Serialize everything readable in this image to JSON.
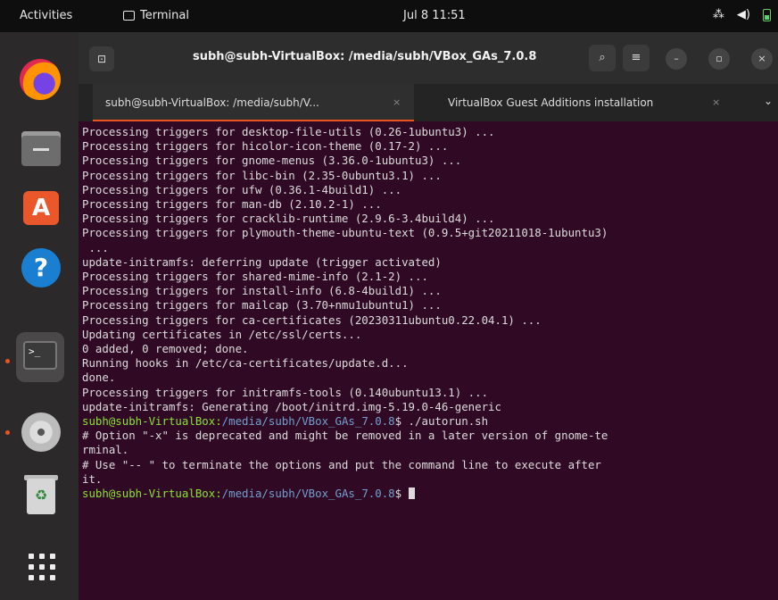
{
  "topbar": {
    "activities": "Activities",
    "app_name": "Terminal",
    "clock": "Jul 8  11:51",
    "tray_icons": [
      "network-icon",
      "volume-icon",
      "battery-icon"
    ]
  },
  "dock": {
    "items": [
      "firefox",
      "files",
      "ubuntu-software",
      "help",
      "terminal",
      "disc",
      "trash",
      "show-applications"
    ],
    "accent": "#e95420"
  },
  "window": {
    "title": "subh@subh-VirtualBox: /media/subh/VBox_GAs_7.0.8",
    "new_tab_icon": "⊡",
    "tabs": [
      {
        "label": "subh@subh-VirtualBox: /media/subh/V...",
        "close": "×"
      },
      {
        "label": "VirtualBox Guest Additions installation",
        "close": "×"
      }
    ],
    "tab_menu": "⌄"
  },
  "terminal": {
    "background": "#300a24",
    "lines": [
      "Processing triggers for desktop-file-utils (0.26-1ubuntu3) ...",
      "Processing triggers for hicolor-icon-theme (0.17-2) ...",
      "Processing triggers for gnome-menus (3.36.0-1ubuntu3) ...",
      "Processing triggers for libc-bin (2.35-0ubuntu3.1) ...",
      "Processing triggers for ufw (0.36.1-4build1) ...",
      "Processing triggers for man-db (2.10.2-1) ...",
      "Processing triggers for cracklib-runtime (2.9.6-3.4build4) ...",
      "Processing triggers for plymouth-theme-ubuntu-text (0.9.5+git20211018-1ubuntu3)",
      " ...",
      "update-initramfs: deferring update (trigger activated)",
      "Processing triggers for shared-mime-info (2.1-2) ...",
      "Processing triggers for install-info (6.8-4build1) ...",
      "Processing triggers for mailcap (3.70+nmu1ubuntu1) ...",
      "Processing triggers for ca-certificates (20230311ubuntu0.22.04.1) ...",
      "Updating certificates in /etc/ssl/certs...",
      "0 added, 0 removed; done.",
      "Running hooks in /etc/ca-certificates/update.d...",
      "done.",
      "Processing triggers for initramfs-tools (0.140ubuntu13.1) ...",
      "update-initramfs: Generating /boot/initrd.img-5.19.0-46-generic"
    ],
    "prompt1": {
      "user": "subh@subh-VirtualBox",
      "path": "/media/subh/VBox_GAs_7.0.8",
      "suffix": "$ ./autorun.sh"
    },
    "warning_lines": [
      "# Option \"-x\" is deprecated and might be removed in a later version of gnome-te",
      "rminal.",
      "# Use \"-- \" to terminate the options and put the command line to execute after",
      "it."
    ],
    "prompt2": {
      "user": "subh@subh-VirtualBox",
      "path": "/media/subh/VBox_GAs_7.0.8",
      "suffix": "$ "
    }
  }
}
